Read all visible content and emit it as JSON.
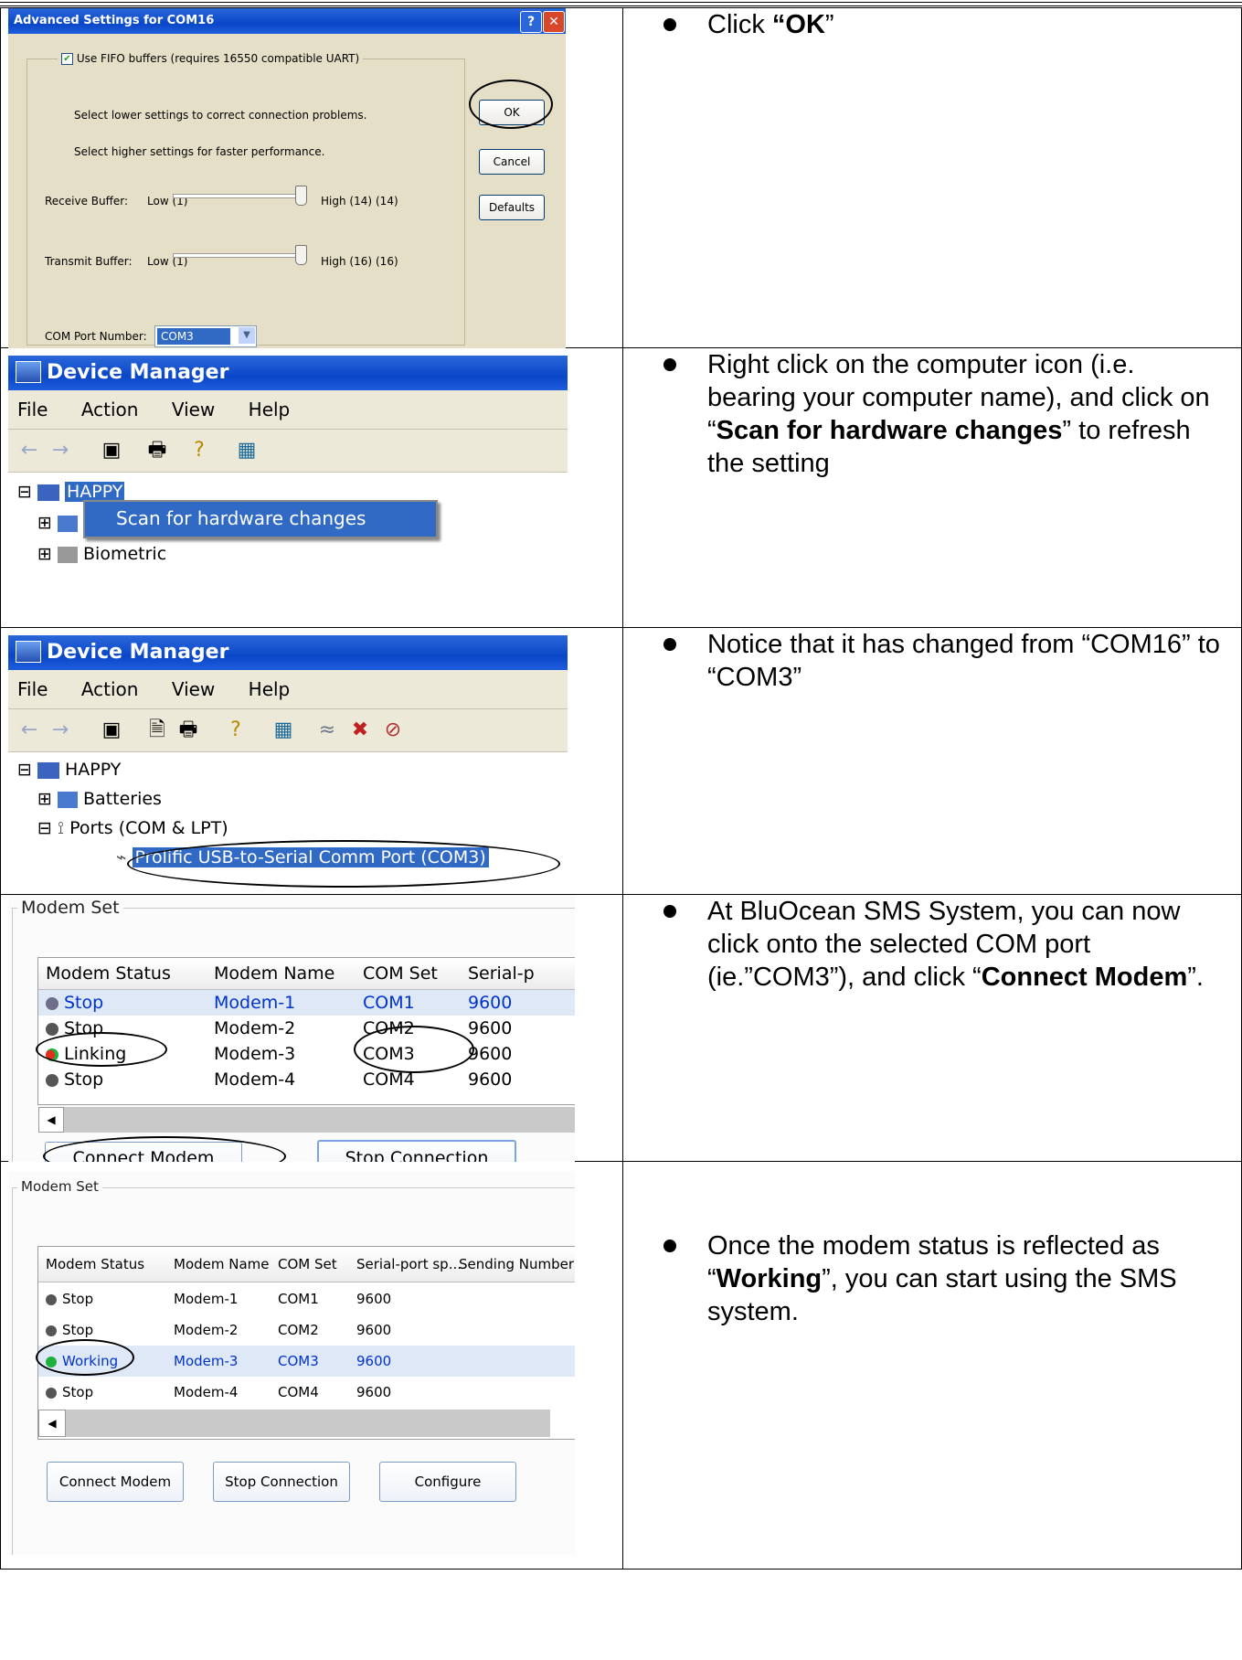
{
  "steps": [
    {
      "text_parts": [
        "Click ",
        "“OK",
        "”"
      ],
      "dialog": {
        "title": "Advanced Settings for COM16",
        "fifo_label": "Use FIFO buffers (requires 16550 compatible UART)",
        "hint_lower": "Select lower settings to correct connection problems.",
        "hint_higher": "Select higher settings for faster performance.",
        "receive_label": "Receive Buffer:",
        "receive_low": "Low (1)",
        "receive_high": "High (14)",
        "receive_value": "(14)",
        "receive_level": 1.0,
        "transmit_label": "Transmit Buffer:",
        "transmit_low": "Low (1)",
        "transmit_high": "High (16)",
        "transmit_value": "(16)",
        "transmit_level": 1.0,
        "com_label": "COM Port Number:",
        "com_value": "COM3",
        "ok": "OK",
        "cancel": "Cancel",
        "defaults": "Defaults"
      }
    },
    {
      "text_parts": [
        "Right click on the computer icon (i.e. bearing your computer name), and click on “",
        "Scan for hardware changes",
        "” to refresh the setting"
      ],
      "window": {
        "title": "Device Manager",
        "menu": [
          "File",
          "Action",
          "View",
          "Help"
        ],
        "tree_root": "HAPPY",
        "context_item": "Scan for hardware changes",
        "tree_item": "Biometric"
      }
    },
    {
      "text_parts": [
        "Notice that it has changed from “COM16” to “COM3”"
      ],
      "window": {
        "title": "Device Manager",
        "menu": [
          "File",
          "Action",
          "View",
          "Help"
        ],
        "tree_root": "HAPPY",
        "tree_items": [
          "Batteries",
          "Ports (COM & LPT)",
          "Prolific USB-to-Serial Comm Port (COM3)"
        ]
      }
    },
    {
      "text_parts": [
        "At BluOcean SMS System, you can now click onto the selected COM port (ie.”COM3”), and click “",
        "Connect Modem",
        "”."
      ],
      "modem": {
        "legend": "Modem Set",
        "headers": [
          "Modem Status",
          "Modem Name",
          "COM Set",
          "Serial-p"
        ],
        "rows": [
          [
            "Stop",
            "Modem-1",
            "COM1",
            "9600"
          ],
          [
            "Stop",
            "Modem-2",
            "COM2",
            "9600"
          ],
          [
            "Linking",
            "Modem-3",
            "COM3",
            "9600"
          ],
          [
            "Stop",
            "Modem-4",
            "COM4",
            "9600"
          ]
        ],
        "buttons": [
          "Connect Modem",
          "Stop Connection"
        ]
      }
    },
    {
      "text_parts": [
        "Once the modem status is reflected as “",
        "Working",
        "”, you can start using the SMS system."
      ],
      "modem": {
        "legend": "Modem Set",
        "headers": [
          "Modem Status",
          "Modem Name",
          "COM Set",
          "Serial-port sp...",
          "Sending Number"
        ],
        "rows": [
          [
            "Stop",
            "Modem-1",
            "COM1",
            "9600"
          ],
          [
            "Stop",
            "Modem-2",
            "COM2",
            "9600"
          ],
          [
            "Working",
            "Modem-3",
            "COM3",
            "9600"
          ],
          [
            "Stop",
            "Modem-4",
            "COM4",
            "9600"
          ]
        ],
        "buttons": [
          "Connect Modem",
          "Stop Connection",
          "Configure"
        ]
      }
    }
  ],
  "colors": {
    "xp_title": "#0a47c8",
    "selection": "#316ac5",
    "selected_text": "#0033cc",
    "status_stop": "#808080",
    "status_linking": "#e03020",
    "status_working": "#20b040"
  },
  "icons": [
    "help-icon",
    "close-icon",
    "computer-icon",
    "back-icon",
    "forward-icon",
    "print-icon",
    "properties-icon",
    "port-icon",
    "battery-icon",
    "dropdown-icon"
  ]
}
